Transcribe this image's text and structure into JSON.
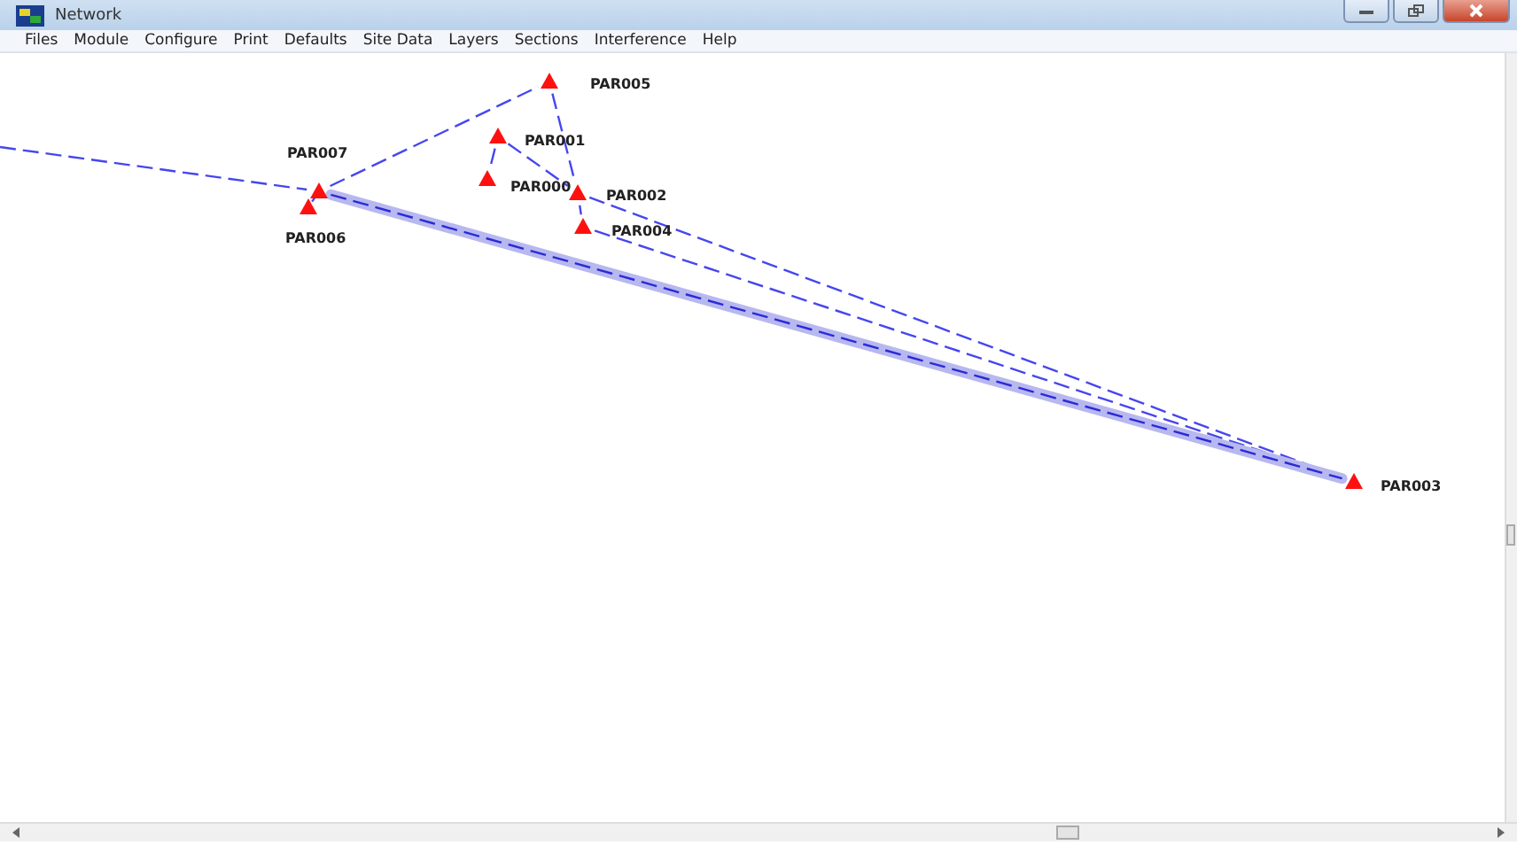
{
  "window": {
    "title": "Network"
  },
  "menu": [
    "Files",
    "Module",
    "Configure",
    "Print",
    "Defaults",
    "Site Data",
    "Layers",
    "Sections",
    "Interference",
    "Help"
  ],
  "sites": [
    {
      "label": "PAR005"
    },
    {
      "label": "PAR001"
    },
    {
      "label": "PAR000"
    },
    {
      "label": "PAR002"
    },
    {
      "label": "PAR004"
    },
    {
      "label": "PAR007"
    },
    {
      "label": "PAR006"
    },
    {
      "label": "PAR003"
    }
  ],
  "links": [
    {
      "selected": false
    },
    {
      "selected": false
    },
    {
      "selected": false
    },
    {
      "selected": false
    },
    {
      "selected": false
    },
    {
      "selected": false
    },
    {
      "selected": false
    },
    {
      "selected": false
    },
    {
      "selected": true
    },
    {
      "selected": false
    }
  ]
}
